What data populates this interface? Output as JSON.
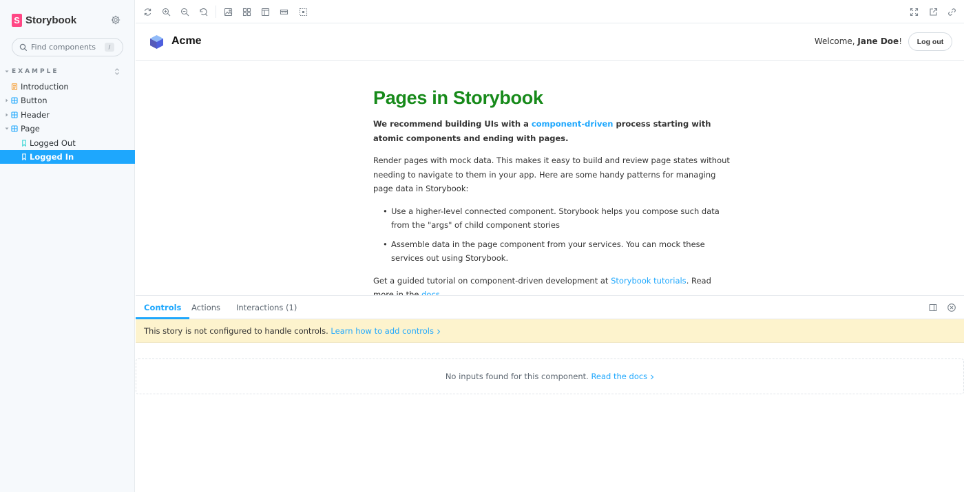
{
  "sidebar": {
    "brand": {
      "mark": "S",
      "name": "Storybook"
    },
    "search": {
      "placeholder": "Find components",
      "shortcut": "/"
    },
    "group": {
      "title": "EXAMPLE",
      "items": [
        {
          "label": "Introduction",
          "type": "docs"
        },
        {
          "label": "Button",
          "type": "component"
        },
        {
          "label": "Header",
          "type": "component"
        },
        {
          "label": "Page",
          "type": "component"
        },
        {
          "label": "Logged Out",
          "type": "story"
        },
        {
          "label": "Logged In",
          "type": "story",
          "selected": true
        }
      ]
    }
  },
  "preview": {
    "header": {
      "app_name": "Acme",
      "welcome_prefix": "Welcome, ",
      "user_name": "Jane Doe",
      "welcome_suffix": "!",
      "logout_label": "Log out"
    },
    "title": "Pages in Storybook",
    "lead": {
      "before": "We recommend building UIs with a ",
      "link": "component-driven",
      "after": " process starting with atomic components and ending with pages."
    },
    "body": "Render pages with mock data. This makes it easy to build and review page states without needing to navigate to them in your app. Here are some handy patterns for managing page data in Storybook:",
    "bullets": [
      "Use a higher-level connected component. Storybook helps you compose such data from the \"args\" of child component stories",
      "Assemble data in the page component from your services. You can mock these services out using Storybook."
    ],
    "tutorial": {
      "before": "Get a guided tutorial on component-driven development at ",
      "link": "Storybook tutorials",
      "middle": ". Read more in the ",
      "docs_link": "docs",
      "after": "."
    }
  },
  "addons": {
    "tabs": [
      {
        "label": "Controls",
        "active": true
      },
      {
        "label": "Actions"
      },
      {
        "label": "Interactions (1)"
      }
    ],
    "notice": {
      "text": "This story is not configured to handle controls. ",
      "link": "Learn how to add controls"
    },
    "empty": {
      "text": "No inputs found for this component. ",
      "link": "Read the docs"
    }
  },
  "colors": {
    "accent": "#1ea7fd",
    "brand": "#ff4785",
    "title_green": "#178a1a",
    "notice_bg": "#fdf3cd",
    "sidebar_bg": "#f6f9fc"
  }
}
